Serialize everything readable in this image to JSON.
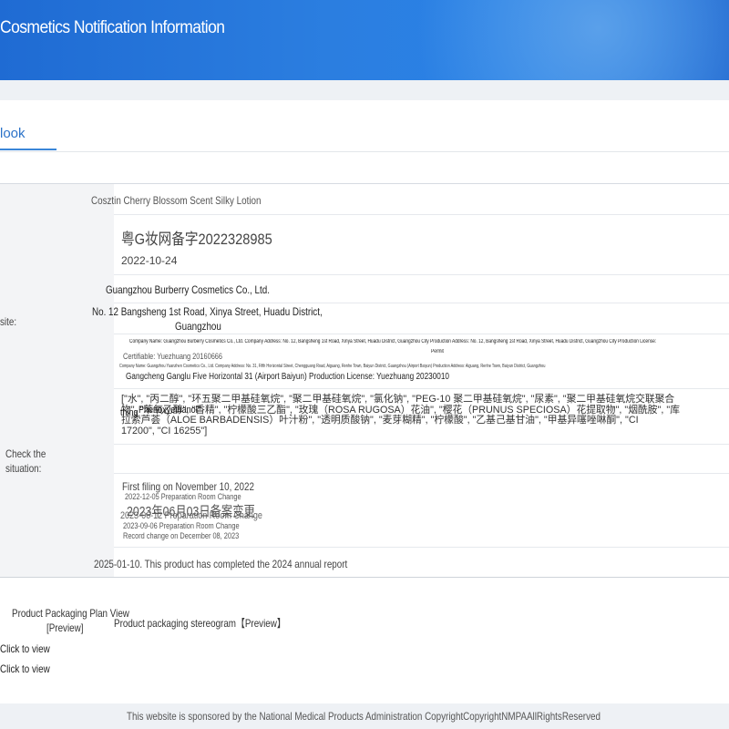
{
  "header": {
    "title": "Cosmetics Notification Information"
  },
  "tabs": {
    "active": "look"
  },
  "detail": {
    "product_name": "Cosztin Cherry Blossom Scent Silky Lotion",
    "notification_number": "粤G妆网备字2022328985",
    "notification_date": "2022-10-24",
    "notifier_name": "Guangzhou Burberry Cosmetics Co., Ltd.",
    "notifier_address_line1": "No. 12 Bangsheng 1st Road, Xinya Street, Huadu District,",
    "notifier_address_line2": "Guangzhou",
    "site_label": "site:",
    "production_company_info": "Company Name: Guangzhou Burberry Cosmetics Co., Ltd. Company Address: No. 12, Bangsheng 1st Road, Xinya Street, Huadu District, Guangzhou City Production Address: No. 12, Bangsheng 1st Road, Xinya Street, Huadu District, Guangzhou City Production License:",
    "permit_label": "Permit",
    "certifiable_text": "Certifiable: Yuezhuang 20160666",
    "production_company_info_2": "Company Name: Guangzhou Yuanzhen Cosmetics Co., Ltd. Company Address: No. 31, Fifth Horizontal Street, Chengguang Road, Aiguang, Renhe Town, Baiyun District, Guangzhou (Airport Baiyun) Production Address: Aiguang, Renhe Town, Baiyun District, Guangzhou",
    "production_address_2": "Gangcheng Ganglu Five Horizontal 31 (Airport Baiyun) Production License: Yuezhuang 20230010",
    "ingredients_line1": "[\"水\", \"丙二醇\", \"环五聚二甲基硅氧烷\", \"聚二甲基硅氧烷\", \"氯化钠\", \"PEG-10 聚二甲基硅氧烷\", \"尿素\", \"聚二甲基硅氧烷交联聚合",
    "ingredients_line2": "物\", \"苯氧乙醇\", \"香精\", \"柠檬酸三乙酯\", \"玫瑰（ROSA RUGOSA）花油\", \"樱花（PRUNUS SPECIOSA）花提取物\", \"烟酰胺\", \"库",
    "ingredients_line3": "拉索芦荟（ALOE BARBADENSIS）叶汁粉\", \"透明质酸钠\", \"麦芽糊精\", \"柠檬酸\", \"乙基己基甘油\", \"甲基异噻唑啉酮\", \"CI",
    "ingredients_line4": "17200\", \"CI 16255\"]",
    "overlay_thing": "thing",
    "overlay_phenoxyethanol": "Phenoxyethanol\"",
    "check_label_line1": "Check the",
    "check_label_line2": "situation:",
    "first_filing": "First filing on November 10, 2022",
    "change_1": "2022-12-05 Preparation Room Change",
    "overlay_date": "2023年06月03日备案变更",
    "change_2": "2023-06-12 Preparation Room Change",
    "change_3": "2023-09-06 Preparation Room Change",
    "change_4": "Record change on December 08, 2023",
    "annual_report": "2025-01-10. This product has completed the 2024 annual report"
  },
  "packaging": {
    "plan_view_label": "Product Packaging Plan View",
    "plan_view_link": "[Preview]",
    "stereogram_label": "Product packaging stereogram【Preview】",
    "click_to_view_1": "Click to view",
    "click_to_view_2": "Click to view"
  },
  "footer": {
    "text": "This website is sponsored by the National Medical Products Administration CopyrightCopyrightNMPAAllRightsReserved"
  },
  "colors": {
    "banner": "#2a7ce0",
    "accent": "#2b72c8"
  }
}
